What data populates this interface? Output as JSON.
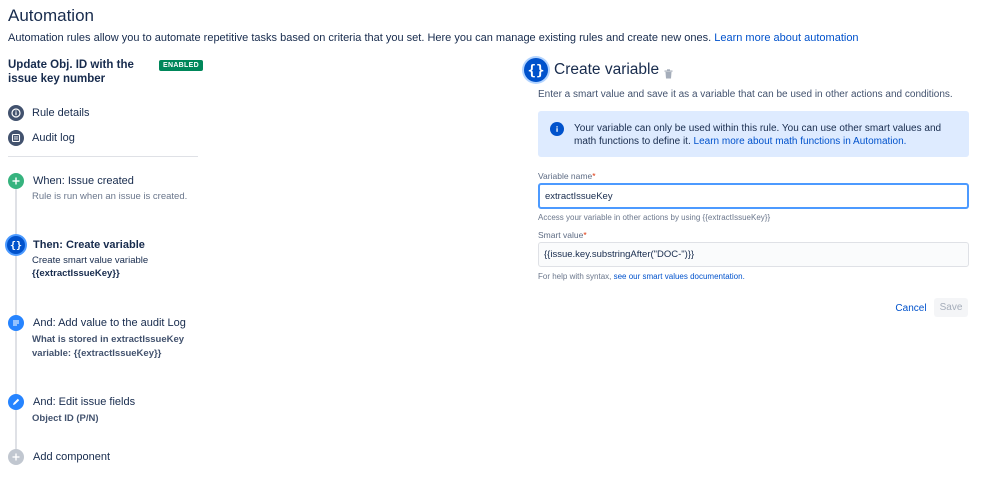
{
  "page": {
    "title": "Automation",
    "intro": "Automation rules allow you to automate repetitive tasks based on criteria that you set. Here you can manage existing rules and create new ones.",
    "intro_link": "Learn more about automation"
  },
  "rule": {
    "title": "Update Obj. ID with the issue key number",
    "status": "ENABLED"
  },
  "nav": {
    "rule_details": "Rule details",
    "audit_log": "Audit log"
  },
  "steps": [
    {
      "title": "When: Issue created",
      "sub1": "Rule is run when an issue is created.",
      "icon": "plus-icon",
      "color": "#36b37e"
    },
    {
      "title": "Then: Create variable",
      "sub1": "Create smart value variable",
      "sub2": "{{extractIssueKey}}",
      "icon": "braces-icon",
      "color": "#0052cc"
    },
    {
      "title": "And: Add value to the audit Log",
      "sub1": "What is stored in extractIssueKey",
      "sub2": "variable: {{extractIssueKey}}",
      "icon": "document-icon",
      "color": "#2684ff"
    },
    {
      "title": "And: Edit issue fields",
      "sub1": "Object ID (P/N)",
      "icon": "pencil-icon",
      "color": "#2684ff"
    },
    {
      "title": "Add component",
      "icon": "plus-icon",
      "color": "#c1c7d0"
    }
  ],
  "panel": {
    "title": "Create variable",
    "description": "Enter a smart value and save it as a variable that can be used in other actions and conditions.",
    "info_text": "Your variable can only be used within this rule. You can use other smart values and math functions to define it.",
    "info_link": "Learn more about math functions in Automation.",
    "variable_name_label": "Variable name",
    "variable_name_value": "extractIssueKey",
    "variable_help": "Access your variable in other actions by using {{extractIssueKey}}",
    "smart_value_label": "Smart value",
    "smart_value_value": "{{issue.key.substringAfter(\"DOC-\")}}",
    "smart_help_prefix": "For help with syntax,",
    "smart_help_link": "see our smart values documentation.",
    "cancel_label": "Cancel",
    "save_label": "Save",
    "required_mark": "*"
  },
  "colors": {
    "accent": "#0052cc",
    "enabled": "#00875a",
    "info_bg": "#deebff",
    "focus": "#4c9aff"
  }
}
